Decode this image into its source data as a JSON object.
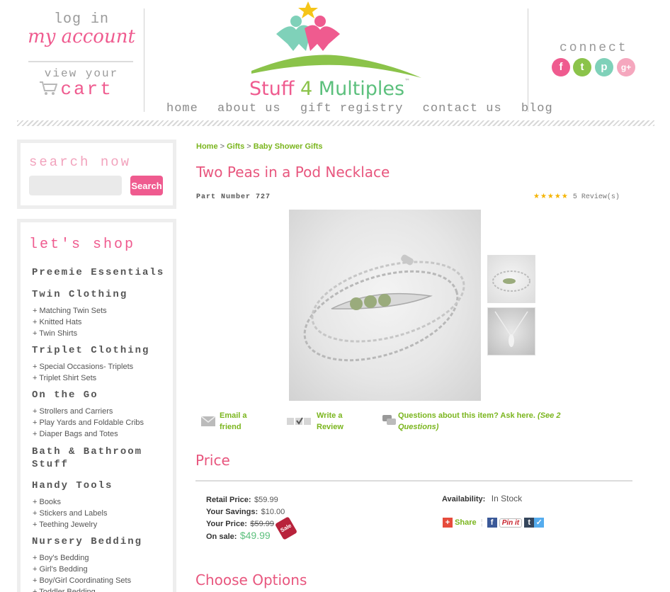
{
  "header": {
    "login_text": "log in",
    "account_text": "my account",
    "view_your": "view your",
    "cart_text": "cart",
    "brand_parts": [
      "Stuff ",
      "4 ",
      "Multiples"
    ],
    "brand_tm": "™",
    "nav": [
      "home",
      "about us",
      "gift registry",
      "contact us",
      "blog"
    ],
    "connect": "connect",
    "social": [
      {
        "label": "f",
        "color": "#ef5b8f",
        "icon": "facebook-icon"
      },
      {
        "label": "t",
        "color": "#8bc34a",
        "icon": "twitter-icon"
      },
      {
        "label": "p",
        "color": "#7fd1b9",
        "icon": "pinterest-icon"
      },
      {
        "label": "g+",
        "color": "#f5a7be",
        "icon": "google-plus-icon"
      }
    ]
  },
  "sidebar": {
    "search_title": "search now",
    "search_button": "Search",
    "shop_title": "let's shop",
    "categories": [
      {
        "name": "Preemie Essentials",
        "items": []
      },
      {
        "name": "Twin Clothing",
        "items": [
          "+ Matching Twin Sets",
          "+ Knitted Hats",
          "+ Twin Shirts"
        ]
      },
      {
        "name": "Triplet Clothing",
        "items": [
          "+ Special Occasions- Triplets",
          "+ Triplet Shirt Sets"
        ]
      },
      {
        "name": "On the Go",
        "items": [
          "+ Strollers and Carriers",
          "+ Play Yards and Foldable Cribs",
          "+ Diaper Bags and Totes"
        ]
      },
      {
        "name": "Bath & Bathroom Stuff",
        "items": []
      },
      {
        "name": "Handy Tools",
        "items": [
          "+ Books",
          "+ Stickers and Labels",
          "+ Teething Jewelry"
        ]
      },
      {
        "name": "Nursery Bedding",
        "items": [
          "+ Boy's Bedding",
          "+ Girl's Bedding",
          "+ Boy/Girl Coordinating Sets",
          "+ Toddler Bedding"
        ]
      }
    ]
  },
  "product": {
    "breadcrumb": [
      "Home",
      "Gifts",
      "Baby Shower Gifts"
    ],
    "breadcrumb_sep": ">",
    "title": "Two Peas in a Pod Necklace",
    "part_number": "Part Number 727",
    "stars": "★★★★★",
    "reviews": "5 Review(s)",
    "actions": {
      "email": "Email a friend",
      "review": "Write a Review",
      "questions": "Questions about this item? Ask here.",
      "questions_count": "(See 2 Questions)"
    },
    "price_title": "Price",
    "retail_label": "Retail Price:",
    "retail_value": "$59.99",
    "savings_label": "Your Savings:",
    "savings_value": "$10.00",
    "your_price_label": "Your Price:",
    "your_price_value": "$59.99",
    "sale_label": "On sale:",
    "sale_value": "$49.99",
    "sale_tag": "Sale",
    "availability_label": "Availability:",
    "availability_value": "In Stock",
    "share_label": "Share",
    "pin_label": "Pin it",
    "options_title": "Choose Options"
  },
  "colors": {
    "pink": "#ef5b8f",
    "green": "#7ab51d",
    "mint": "#5cc07d"
  }
}
